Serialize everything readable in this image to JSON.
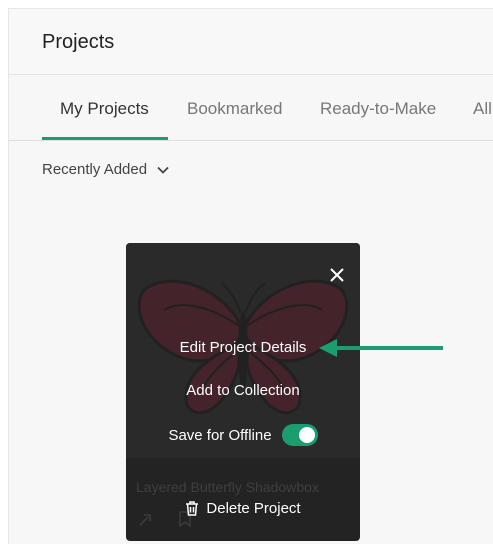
{
  "page": {
    "title": "Projects"
  },
  "tabs": [
    {
      "label": "My Projects",
      "active": true
    },
    {
      "label": "Bookmarked",
      "active": false
    },
    {
      "label": "Ready-to-Make",
      "active": false
    },
    {
      "label": "All",
      "active": false
    }
  ],
  "sort": {
    "label": "Recently Added",
    "icon": "chevron-down-icon"
  },
  "project_card": {
    "title": "Layered Butterfly Shadowbox",
    "thumbnail_icon": "butterfly-icon",
    "menu": {
      "edit_label": "Edit Project Details",
      "collection_label": "Add to Collection",
      "offline_label": "Save for Offline",
      "offline_enabled": true,
      "delete_label": "Delete Project",
      "close_icon": "close-icon",
      "delete_icon": "trash-icon"
    }
  },
  "colors": {
    "accent": "#1b9e6f",
    "overlay": "#232323"
  }
}
